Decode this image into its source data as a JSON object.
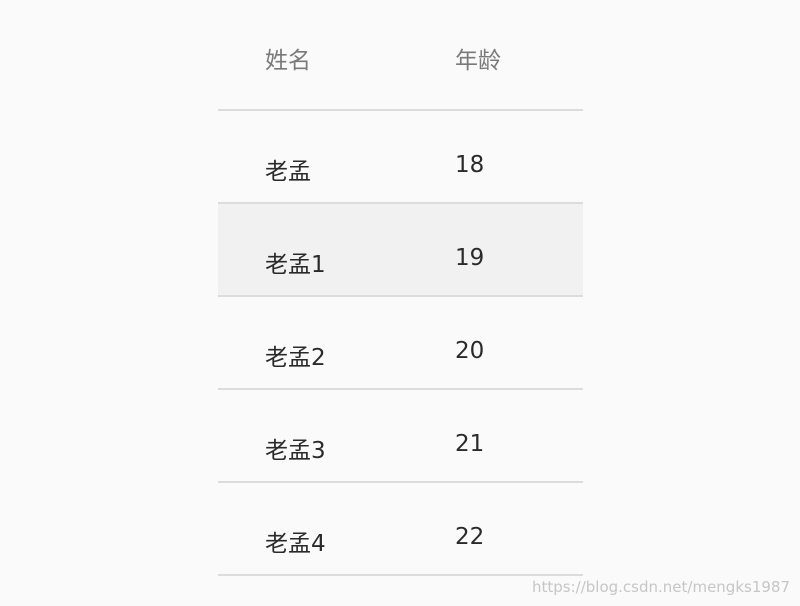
{
  "table": {
    "headers": {
      "name": "姓名",
      "age": "年龄"
    },
    "rows": [
      {
        "name": "老孟",
        "age": "18"
      },
      {
        "name": "老孟1",
        "age": "19"
      },
      {
        "name": "老孟2",
        "age": "20"
      },
      {
        "name": "老孟3",
        "age": "21"
      },
      {
        "name": "老孟4",
        "age": "22"
      }
    ],
    "highlighted_row": 1
  },
  "watermark": "https://blog.csdn.net/mengks1987"
}
